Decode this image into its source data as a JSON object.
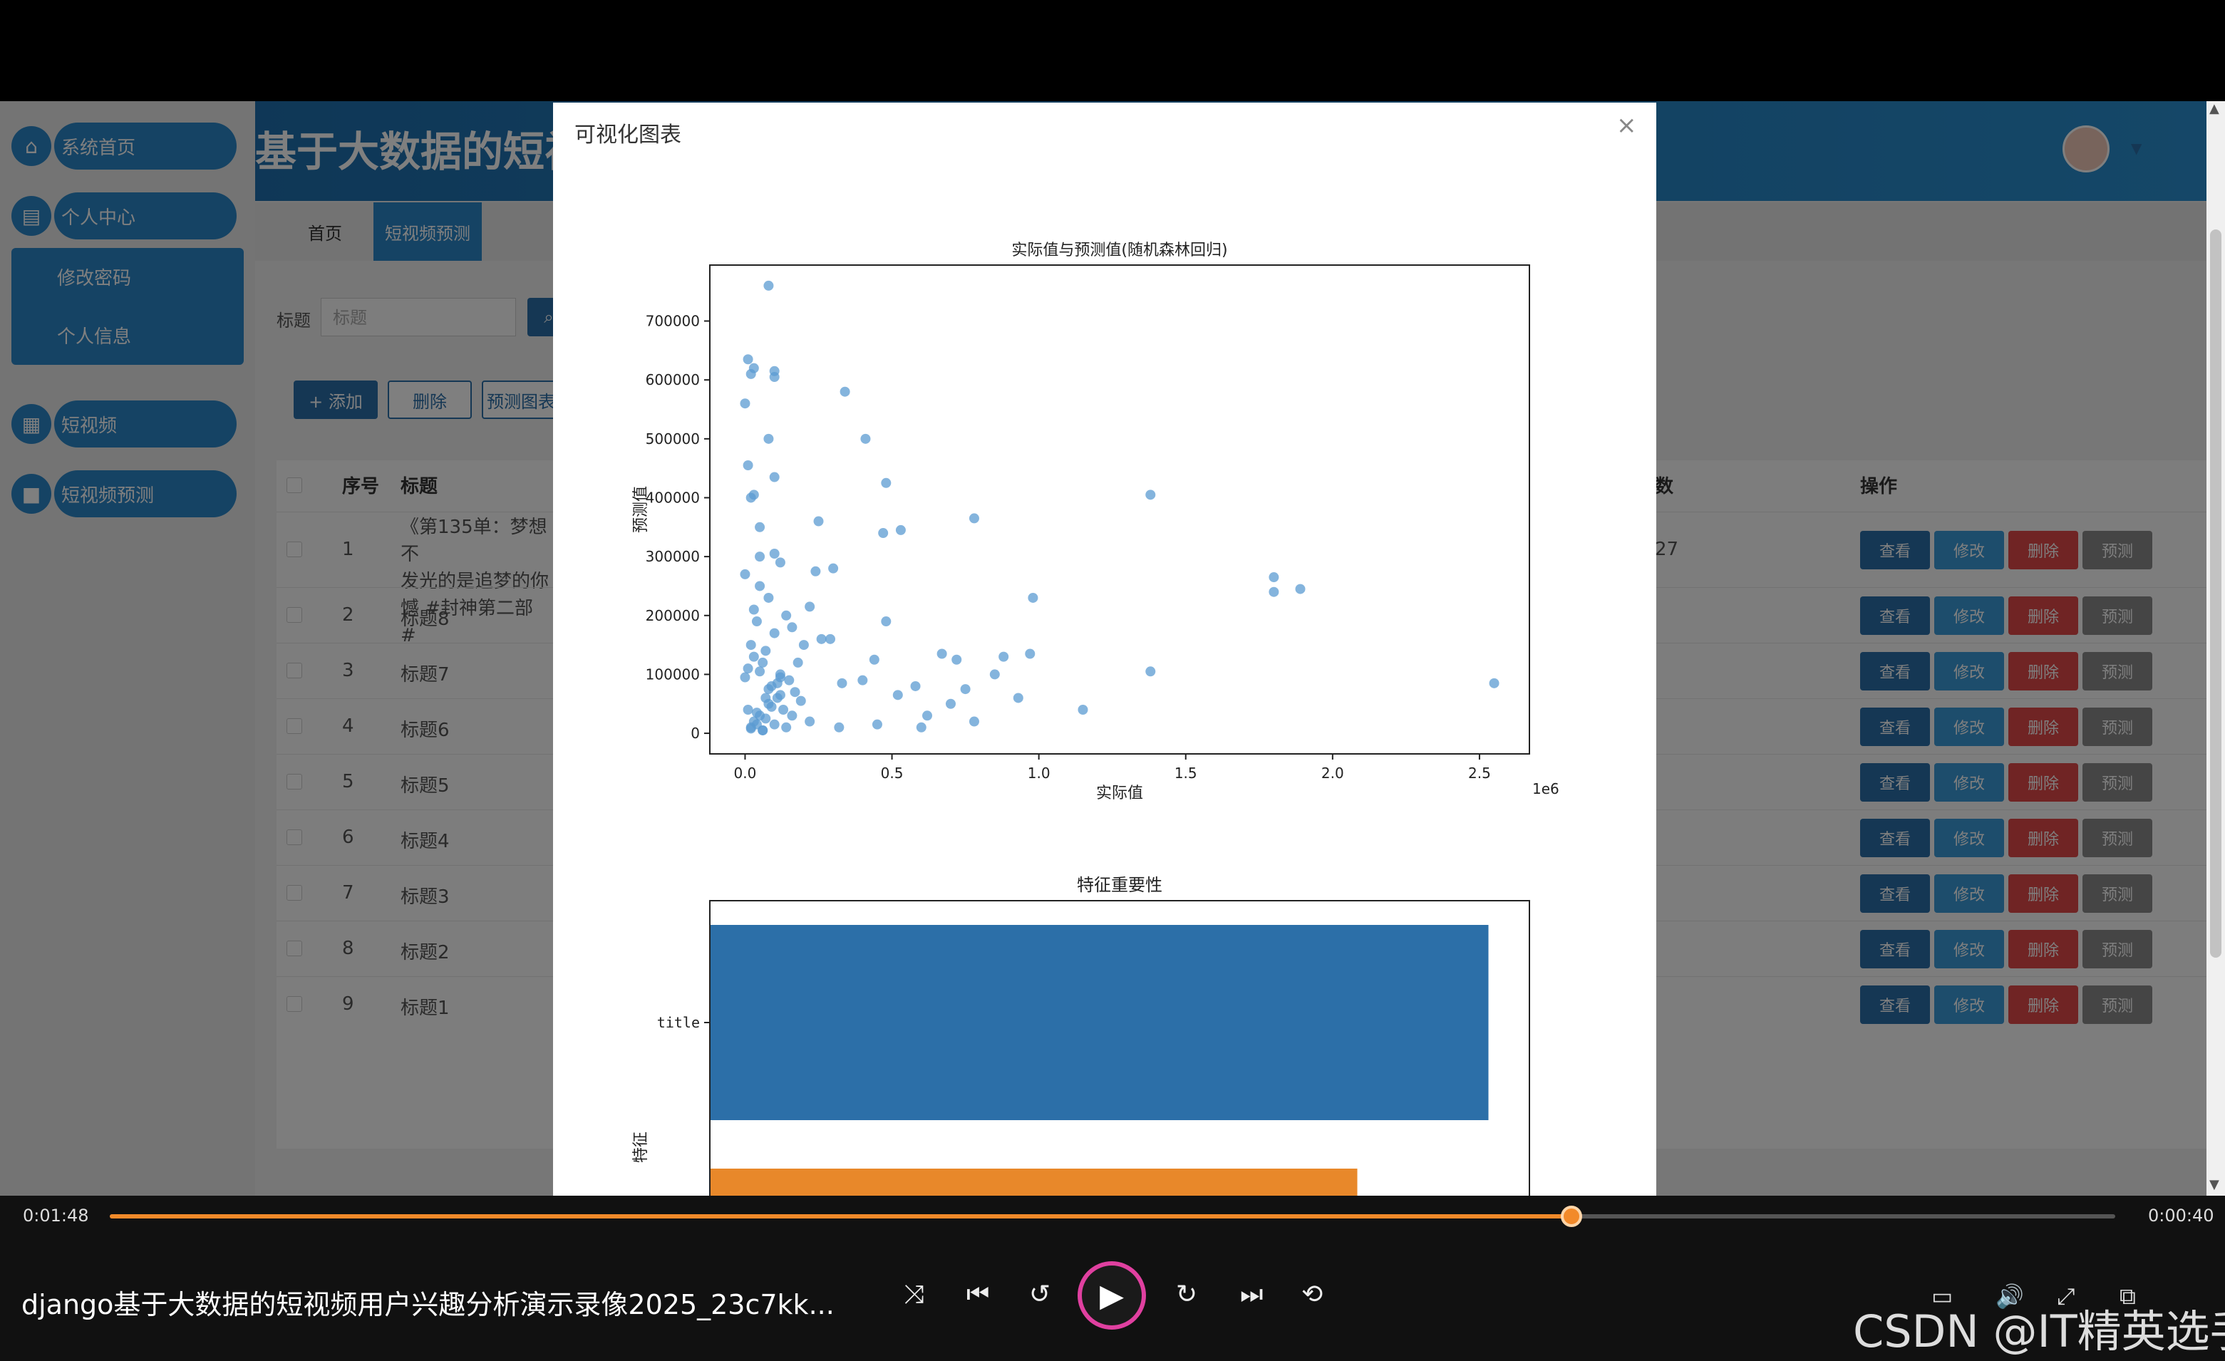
{
  "sidebar": {
    "items": [
      {
        "label": "系统首页"
      },
      {
        "label": "个人中心"
      },
      {
        "label": "短视频"
      },
      {
        "label": "短视频预测"
      }
    ],
    "sub_items": [
      "修改密码",
      "个人信息"
    ]
  },
  "header": {
    "title": "基于大数据的短视频用户兴趣分析"
  },
  "tabs": [
    {
      "label": "首页"
    },
    {
      "label": "短视频预测"
    }
  ],
  "search": {
    "label": "标题",
    "placeholder": "标题",
    "icon": "search-icon"
  },
  "actions": {
    "add": "+ 添加",
    "delete": "删除",
    "chart": "预测图表"
  },
  "table": {
    "headers": [
      "序号",
      "标题",
      "数",
      "操作"
    ],
    "rows": [
      {
        "index": "1",
        "title": "《第135单：梦想不",
        "title_l2": "发光的是追梦的你",
        "title_l3": "憾 #封神第二部 #",
        "num": "27"
      },
      {
        "index": "2",
        "title": "标题8"
      },
      {
        "index": "3",
        "title": "标题7"
      },
      {
        "index": "4",
        "title": "标题6"
      },
      {
        "index": "5",
        "title": "标题5"
      },
      {
        "index": "6",
        "title": "标题4"
      },
      {
        "index": "7",
        "title": "标题3"
      },
      {
        "index": "8",
        "title": "标题2"
      },
      {
        "index": "9",
        "title": "标题1"
      }
    ],
    "op_labels": {
      "view": "查看",
      "edit": "修改",
      "delete": "删除",
      "predict": "预测"
    }
  },
  "modal": {
    "title": "可视化图表",
    "close": "×"
  },
  "chart_data": [
    {
      "type": "scatter",
      "title": "实际值与预测值(随机森林回归)",
      "xlabel": "实际值",
      "ylabel": "预测值",
      "x_offset_label": "1e6",
      "xlim": [
        -0.12,
        2.67
      ],
      "ylim": [
        -35000,
        795000
      ],
      "xticks": [
        "0.0",
        "0.5",
        "1.0",
        "1.5",
        "2.0",
        "2.5"
      ],
      "yticks": [
        "0",
        "100000",
        "200000",
        "300000",
        "400000",
        "500000",
        "600000",
        "700000"
      ],
      "color": "#5b9bd1",
      "x": [
        0.08,
        0.01,
        0.02,
        0.03,
        0.1,
        0.1,
        0.34,
        0.0,
        0.08,
        0.41,
        0.01,
        0.1,
        0.48,
        0.03,
        0.02,
        0.25,
        0.05,
        0.47,
        0.53,
        0.78,
        1.38,
        0.1,
        0.05,
        0.12,
        0.3,
        0.24,
        1.8,
        1.89,
        1.8,
        0.98,
        0.22,
        0.48,
        0.29,
        0.97,
        0.67,
        0.72,
        0.88,
        0.44,
        1.38,
        0.85,
        0.12,
        0.4,
        0.33,
        0.58,
        0.75,
        0.93,
        1.15,
        2.55,
        0.52,
        0.62,
        0.7,
        0.78,
        0.6,
        0.32,
        0.22,
        0.45,
        0.16,
        0.26,
        0.05,
        0.0,
        0.08,
        0.14,
        0.2,
        0.03,
        0.1,
        0.18,
        0.07,
        0.12,
        0.04,
        0.15,
        0.09,
        0.02,
        0.06,
        0.11,
        0.17,
        0.01,
        0.08,
        0.13,
        0.05,
        0.19,
        0.03,
        0.07,
        0.1,
        0.14,
        0.02,
        0.06,
        0.09,
        0.04,
        0.12,
        0.16,
        0.0,
        0.05,
        0.08,
        0.03,
        0.11,
        0.07,
        0.01,
        0.04,
        0.06,
        0.02
      ],
      "y": [
        760000,
        635000,
        610000,
        620000,
        615000,
        605000,
        580000,
        560000,
        500000,
        500000,
        455000,
        435000,
        425000,
        405000,
        400000,
        360000,
        350000,
        340000,
        345000,
        365000,
        405000,
        305000,
        300000,
        290000,
        280000,
        275000,
        265000,
        245000,
        240000,
        230000,
        215000,
        190000,
        160000,
        135000,
        135000,
        125000,
        130000,
        125000,
        105000,
        100000,
        95000,
        90000,
        85000,
        80000,
        75000,
        60000,
        40000,
        85000,
        65000,
        30000,
        50000,
        20000,
        10000,
        10000,
        20000,
        15000,
        180000,
        160000,
        250000,
        270000,
        230000,
        200000,
        150000,
        210000,
        170000,
        120000,
        140000,
        100000,
        190000,
        90000,
        80000,
        150000,
        120000,
        60000,
        70000,
        110000,
        50000,
        40000,
        30000,
        55000,
        20000,
        25000,
        15000,
        10000,
        8000,
        5000,
        45000,
        35000,
        65000,
        30000,
        95000,
        105000,
        75000,
        130000,
        85000,
        60000,
        40000,
        15000,
        5000,
        10000
      ]
    },
    {
      "type": "bar",
      "orientation": "horizontal",
      "title": "特征重要性",
      "ylabel": "特征",
      "categories": [
        "title",
        ""
      ],
      "values": [
        0.95,
        0.79
      ],
      "colors": [
        "#2c6fa8",
        "#e8882a"
      ]
    }
  ],
  "player": {
    "time_current": "0:01:48",
    "time_remaining": "0:00:40",
    "progress": 0.729,
    "video_title": "django基于大数据的短视频用户兴趣分析演示录像2025_23c7kk...",
    "watermark": "CSDN @IT精英选手",
    "icons": [
      "shuffle-icon",
      "previous-icon",
      "rewind-10-icon",
      "play-icon",
      "forward-30-icon",
      "next-icon",
      "repeat-icon",
      "subtitles-icon",
      "volume-icon",
      "fullscreen-icon",
      "mini-player-icon"
    ]
  }
}
